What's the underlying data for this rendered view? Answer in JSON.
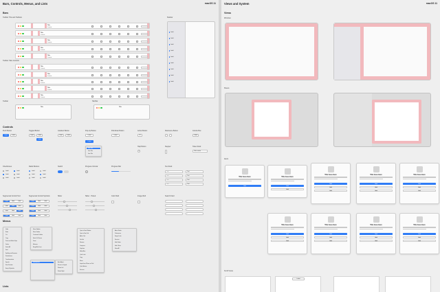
{
  "left": {
    "header": "Bars, Controls, Menus, and Lists",
    "version": "macOS 11",
    "bars": {
      "title": "Bars",
      "toolbar_title_caption": "Toolbar: Title and Toolbars",
      "sidebar_caption": "Sidebar",
      "toolbar_segment_caption": "Toolbar: Tabs Controls",
      "toolbar_caption": "Toolbar",
      "tab_bar_caption": "Tab Bar",
      "window_title": "Title",
      "window_subtitle": "Subtitle",
      "tab_labels": [
        "Title",
        "Title"
      ],
      "sidebar_items": [
        "Label",
        "Label",
        "Label",
        "Label",
        "Label",
        "Label",
        "Label",
        "Label",
        "Label"
      ]
    },
    "controls": {
      "title": "Controls",
      "push_button_caption": "Push Button",
      "toggle_button_caption": "Toggled Button",
      "gradient_caption": "Gradient Button",
      "popup_caption": "Pop-Up Button",
      "pulldown_caption": "Pull-Down Button",
      "action_caption": "Action Button",
      "disclosure_caption": "Disclosure Button",
      "help_caption": "Help Button",
      "stepper_caption": "Stepper",
      "combo_caption": "Combo Box",
      "checkbox_caption": "Checkboxes",
      "radio_caption": "Radio Buttons",
      "switch_caption": "Switch",
      "progress_caption": "Progress Circular",
      "progress_bar_caption": "Progress Bar",
      "text_field_caption": "Text Field",
      "segmented_caption": "Segmented Control Text",
      "segmented_symbol_caption": "Segmented Control Symbols",
      "slider_caption": "Slider",
      "slider_ticks_caption": "Slider - Ticked",
      "color_well_caption": "Color Well",
      "image_well_caption": "Image Well",
      "search_caption": "Search Field",
      "token_caption": "Token Field",
      "button_label": "Label",
      "popup_options": [
        "Item Title",
        "Item Title",
        "Item Title"
      ],
      "combo_value": "Title is what",
      "checkbox_label": "Label",
      "field_placeholder": "Text",
      "segment_label": "Label"
    },
    "menus": {
      "title": "Menus",
      "menu1": [
        "Undo",
        "Redo",
        "Cut",
        "Copy",
        "Paste and Match Style",
        "Delete",
        "Select All",
        "Find",
        "Spelling and Grammar",
        "Substitutions",
        "Transformations",
        "Speech",
        "Start Dictation",
        "Emoji & Symbols"
      ],
      "menu2": [
        "Show Sidebar",
        "Show Toolbar",
        "Customize Toolbar",
        "Enter Full Screen",
        "Zoom",
        "Minimize",
        "Bring All to Front"
      ],
      "menu3": [
        "Open in New Window",
        "Open in New Tab",
        "Add to Tab",
        "Get Info",
        "Rename",
        "Compress",
        "Duplicate",
        "Make Alias",
        "Quick Look",
        "Copy",
        "Share",
        "Import from iPhone or iPad",
        "Quick Actions",
        "Services"
      ],
      "menu4": [
        "About Finder",
        "Preferences",
        "Empty Trash",
        "Services",
        "Hide Finder",
        "Hide Others",
        "Show All"
      ],
      "menu5": [
        "Auto Adjust",
        "Revert to Original",
        "Rotate Left",
        "Rotate Right"
      ],
      "selected_item": "Substitutions"
    },
    "lists_title": "Lists"
  },
  "right": {
    "header": "Views and System",
    "version": "macOS 11",
    "views_title": "Views",
    "windows_caption": "Windows",
    "sheets_caption": "Sheets",
    "alerts_caption": "Alerts",
    "scroll_caption": "Scroll Views",
    "alert": {
      "title": "Title Goes Here",
      "buttons": [
        "Label",
        "Label",
        "Label",
        "Label"
      ],
      "checkbox": "Label"
    },
    "segment_label": "Label"
  },
  "colors": {
    "accent": "#2f7cf6",
    "placeholder_pink": "#f2b9bd",
    "red_light": "#ff5f57",
    "yellow_light": "#febc2e",
    "green_light": "#28c840"
  }
}
